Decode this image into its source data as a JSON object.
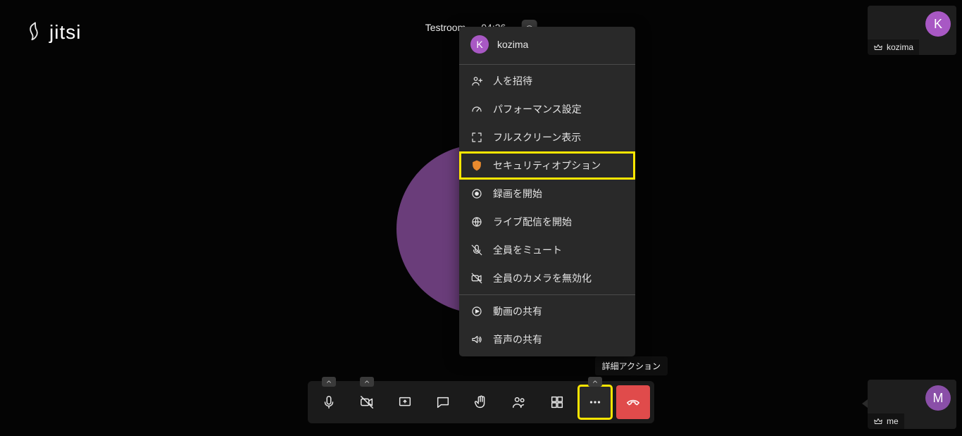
{
  "brand": {
    "name": "jitsi"
  },
  "header": {
    "room_name": "Testroom",
    "timer": "04:26"
  },
  "participants": {
    "remote": {
      "initial": "K",
      "name": "kozima"
    },
    "local": {
      "initial": "M",
      "name": "me"
    }
  },
  "menu": {
    "user_initial": "K",
    "user_name": "kozima",
    "items": {
      "invite": "人を招待",
      "performance": "パフォーマンス設定",
      "fullscreen": "フルスクリーン表示",
      "security": "セキュリティオプション",
      "record": "録画を開始",
      "livestream": "ライブ配信を開始",
      "mute_all": "全員をミュート",
      "disable_cams": "全員のカメラを無効化",
      "share_video": "動画の共有",
      "share_audio": "音声の共有"
    }
  },
  "tooltip": {
    "more_actions": "詳細アクション"
  },
  "colors": {
    "highlight": "#ffe600",
    "hangup": "#e04b4b",
    "accent": "#7b4a8e"
  }
}
